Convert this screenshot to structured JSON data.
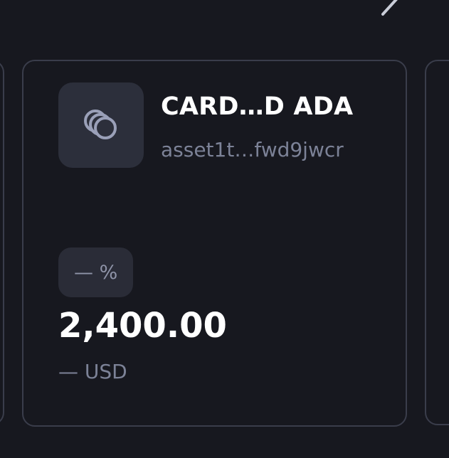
{
  "token_card": {
    "name": "CARD…D ADA",
    "asset_id": "asset1t…fwd9jwcr",
    "change": "— %",
    "amount": "2,400.00",
    "fiat_value": "— USD",
    "icon": "coins-stack-icon"
  },
  "colors": {
    "background": "#17181f",
    "card_border": "#3a3d4b",
    "icon_tile": "#2c2f3b",
    "icon": "#9aa0b8",
    "muted_text": "#7c8297",
    "badge_bg": "#2a2c37"
  }
}
